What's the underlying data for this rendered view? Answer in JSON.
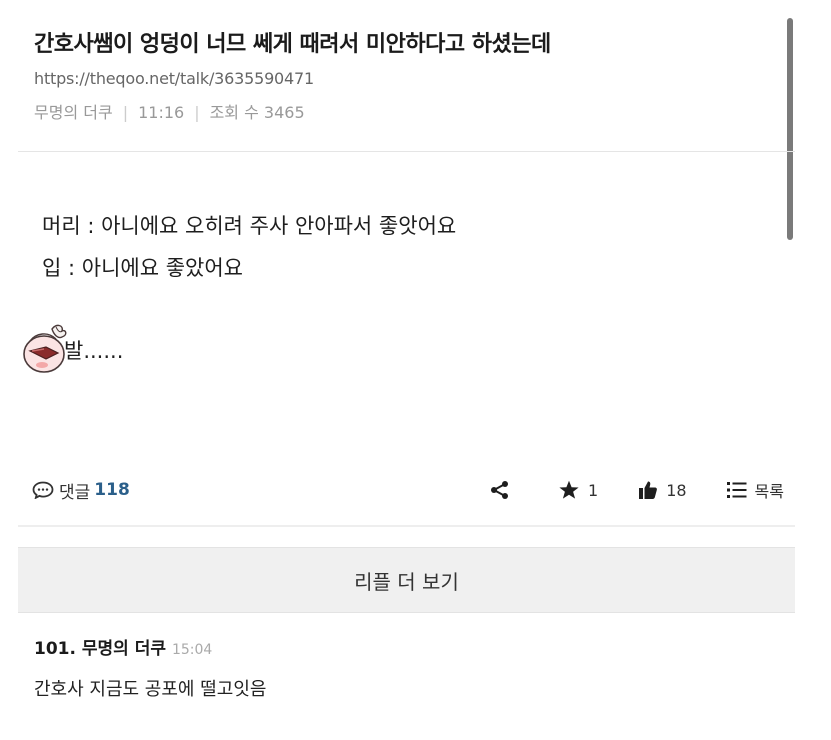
{
  "post": {
    "title": "간호사쌤이 엉덩이 너므 쎄게 때려서 미안하다고 하셨는데",
    "url": "https://theqoo.net/talk/3635590471",
    "author": "무명의 더쿠",
    "time": "11:16",
    "views": "조회 수 3465",
    "body_lines": [
      "머리 : 아니에요 오히려 주사 안아파서 좋앗어요",
      "입 : 아니에요 좋았어요"
    ],
    "sticker_icon": "crying-peach-sticker",
    "sticker_text": "발......"
  },
  "actions": {
    "comment_label": "댓글",
    "comment_count": "118",
    "share_icon": "share-icon",
    "star_count": "1",
    "like_count": "18",
    "list_label": "목록"
  },
  "more_replies_label": "리플 더 보기",
  "reply": {
    "number_author": "101. 무명의 더쿠",
    "time": "15:04",
    "text": "간호사 지금도 공포에 떨고잇음"
  },
  "colors": {
    "comment_count": "#2b5f8a",
    "more_bg": "#f0f0f0",
    "meta": "#999999"
  }
}
